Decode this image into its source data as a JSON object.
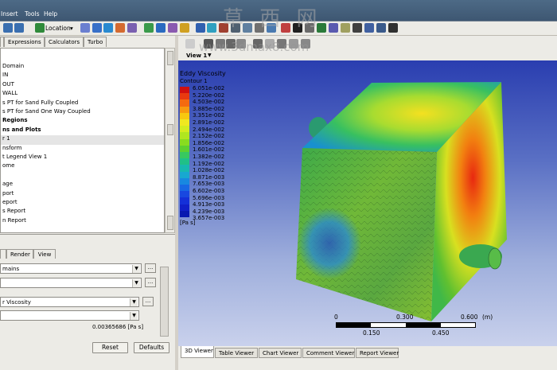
{
  "menu": {
    "items": [
      "Insert",
      "Tools",
      "Help"
    ]
  },
  "toolbar": {
    "location_label": "Location"
  },
  "left_tabs": [
    "Expressions",
    "Calculators",
    "Turbo"
  ],
  "tree": {
    "rows": [
      {
        "text": "Domain",
        "bold": false,
        "sel": false
      },
      {
        "text": "IN",
        "bold": false,
        "sel": false
      },
      {
        "text": "OUT",
        "bold": false,
        "sel": false
      },
      {
        "text": "WALL",
        "bold": false,
        "sel": false
      },
      {
        "text": "s PT for Sand Fully Coupled",
        "bold": false,
        "sel": false
      },
      {
        "text": "s PT for Sand One Way Coupled",
        "bold": false,
        "sel": false
      },
      {
        "text": "Regions",
        "bold": true,
        "sel": false
      },
      {
        "text": "ns and Plots",
        "bold": true,
        "sel": false
      },
      {
        "text": "r 1",
        "bold": false,
        "sel": true
      },
      {
        "text": "nsform",
        "bold": false,
        "sel": false
      },
      {
        "text": "t Legend View 1",
        "bold": false,
        "sel": false
      },
      {
        "text": "ome",
        "bold": false,
        "sel": false
      },
      {
        "text": "",
        "bold": false,
        "sel": false
      },
      {
        "text": "age",
        "bold": false,
        "sel": false
      },
      {
        "text": "port",
        "bold": false,
        "sel": false
      },
      {
        "text": "eport",
        "bold": false,
        "sel": false
      },
      {
        "text": "s Report",
        "bold": false,
        "sel": false
      },
      {
        "text": "n Report",
        "bold": false,
        "sel": false
      }
    ]
  },
  "details_tabs": [
    "Render",
    "View"
  ],
  "details": {
    "domains_value": "mains",
    "variable_value": "r Viscosity",
    "range_value": "0.00365686 [Pa s]",
    "reset_label": "Reset",
    "defaults_label": "Defaults"
  },
  "view_label": "View 1",
  "legend": {
    "title": "Eddy Viscosity",
    "subtitle": "Contour 1",
    "unit": "[Pa s]",
    "labels": [
      "6.051e-002",
      "5.220e-002",
      "4.503e-002",
      "3.885e-002",
      "3.351e-002",
      "2.891e-002",
      "2.494e-002",
      "2.152e-002",
      "1.856e-002",
      "1.601e-002",
      "1.382e-002",
      "1.192e-002",
      "1.028e-002",
      "8.871e-003",
      "7.653e-003",
      "6.602e-003",
      "5.696e-003",
      "4.913e-003",
      "4.239e-003",
      "3.657e-003"
    ],
    "colors": [
      "#d01010",
      "#e83a10",
      "#f46a10",
      "#f89a10",
      "#f8c810",
      "#f0e820",
      "#d4ec20",
      "#b0e620",
      "#88dc20",
      "#5ed030",
      "#38c860",
      "#20c088",
      "#18b8b0",
      "#18a8d0",
      "#1888e0",
      "#1868e4",
      "#1848e0",
      "#1430d8",
      "#1020c8",
      "#0818b0"
    ]
  },
  "scale": {
    "top_labels": [
      "0",
      "0.300",
      "0.600"
    ],
    "unit": "(m)",
    "bottom_labels": [
      "0.150",
      "0.450"
    ]
  },
  "bottom_tabs": [
    "3D Viewer",
    "Table Viewer",
    "Chart Viewer",
    "Comment Viewer",
    "Report Viewer"
  ],
  "watermark": {
    "cn": "草 西 网",
    "url": "www.3dmax8.com"
  }
}
